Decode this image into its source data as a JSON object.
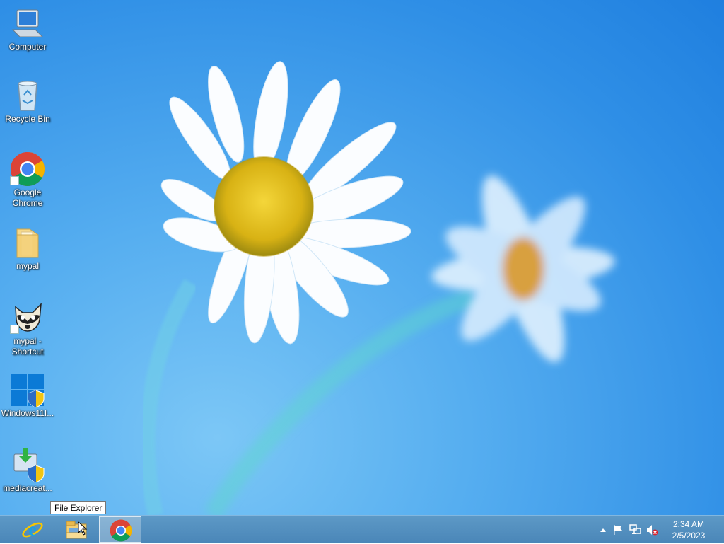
{
  "desktop": {
    "icons": [
      {
        "name": "computer-icon",
        "label": "Computer"
      },
      {
        "name": "recycle-bin-icon",
        "label": "Recycle Bin"
      },
      {
        "name": "google-chrome-icon",
        "label": "Google\nChrome"
      },
      {
        "name": "folder-icon",
        "label": "mypal"
      },
      {
        "name": "raccoon-icon",
        "label": "mypal -\nShortcut"
      },
      {
        "name": "windows-logo-shield-icon",
        "label": "Windows11I..."
      },
      {
        "name": "media-creation-icon",
        "label": "mediacreat..."
      }
    ]
  },
  "taskbar": {
    "pinned": [
      {
        "name": "internet-explorer-icon"
      },
      {
        "name": "file-explorer-icon"
      },
      {
        "name": "chrome-icon"
      }
    ],
    "tooltip": "File Explorer",
    "tray": {
      "icons": [
        "show-hidden-icons-chevron",
        "action-center-flag-icon",
        "network-icon",
        "volume-muted-icon"
      ]
    },
    "clock": {
      "time": "2:34 AM",
      "date": "2/5/2023"
    }
  }
}
